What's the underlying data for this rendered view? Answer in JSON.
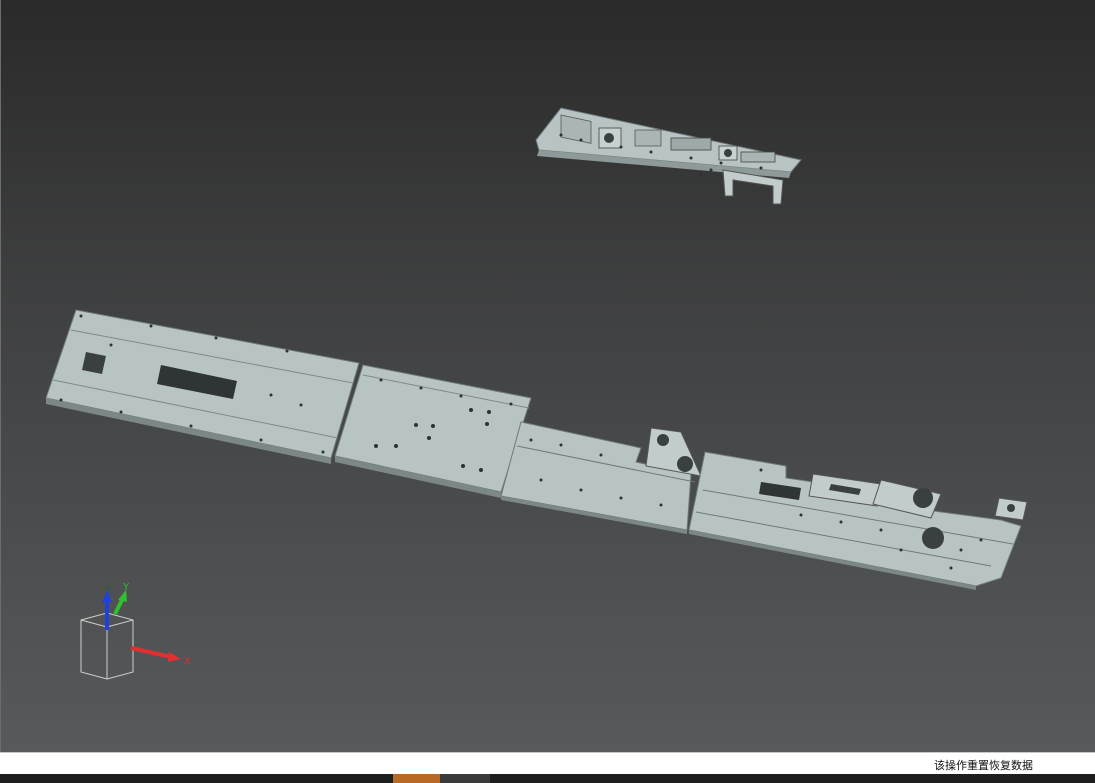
{
  "status_bar": {
    "message": "该操作重置恢复数据"
  },
  "axis_triad": {
    "x_label": "X",
    "y_label": "Y",
    "z_label": "Z",
    "x_color": "#e03030",
    "y_color": "#2fbf2f",
    "z_color": "#1f3fe0"
  },
  "colors": {
    "plate_fill": "#b8c4c4",
    "plate_edge": "#7f8a8a",
    "hole": "#2d3232",
    "background_top": "#2a2a2a",
    "background_bottom": "#57595b",
    "taskbar_active": "#b86a25"
  }
}
